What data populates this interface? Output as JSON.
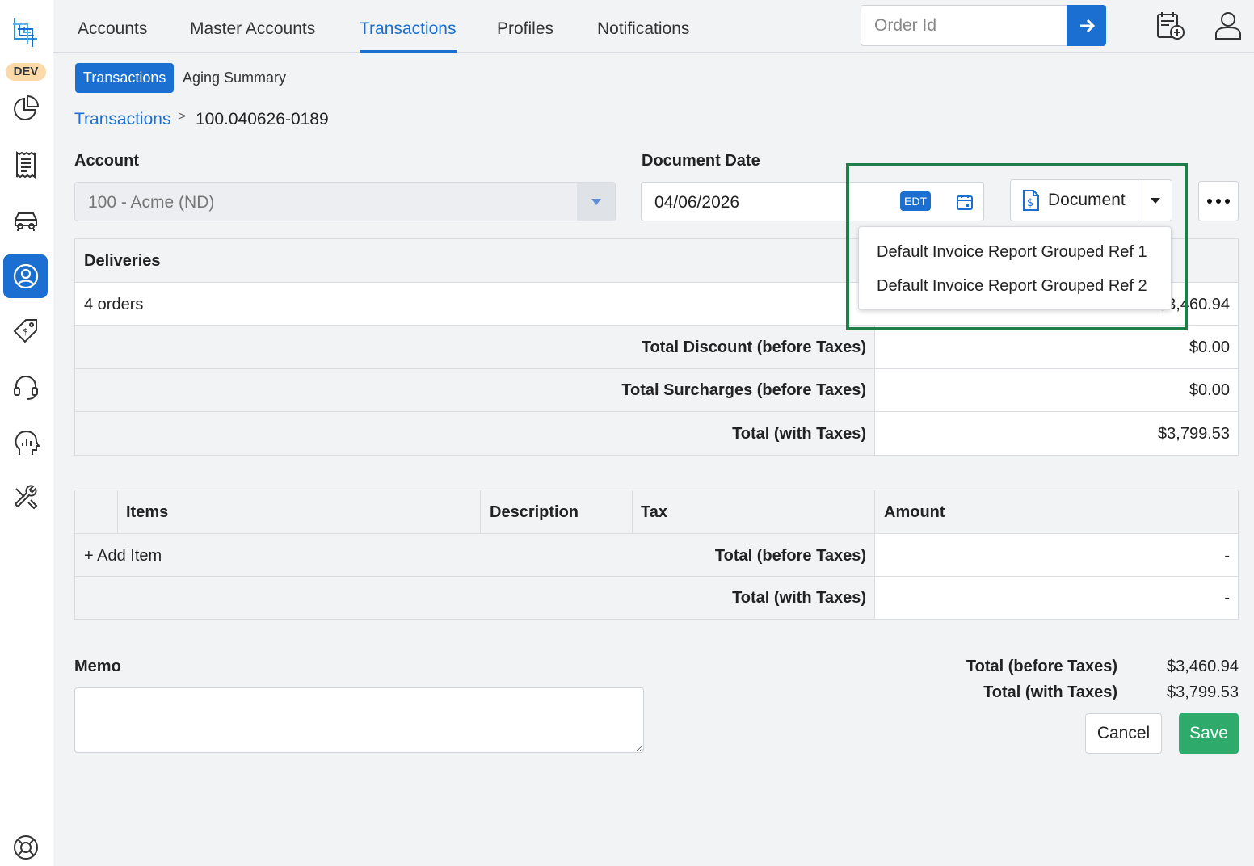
{
  "sidebar": {
    "env_badge": "DEV",
    "items": [
      {
        "icon": "pie-chart-icon"
      },
      {
        "icon": "receipt-icon"
      },
      {
        "icon": "truck-icon"
      },
      {
        "icon": "user-circle-icon",
        "active": true
      },
      {
        "icon": "price-tag-icon"
      },
      {
        "icon": "headset-icon"
      },
      {
        "icon": "analytics-head-icon"
      },
      {
        "icon": "tools-icon"
      },
      {
        "icon": "lifebuoy-icon"
      }
    ]
  },
  "topnav": {
    "tabs": [
      "Accounts",
      "Master Accounts",
      "Transactions",
      "Profiles",
      "Notifications"
    ],
    "active_tab": "Transactions",
    "order_placeholder": "Order Id"
  },
  "subtabs": [
    "Transactions",
    "Aging Summary"
  ],
  "breadcrumb": {
    "parent": "Transactions",
    "separator": ">",
    "current": "100.040626-0189"
  },
  "form": {
    "account_label": "Account",
    "account_value": "100 - Acme (ND)",
    "date_label": "Document Date",
    "date_value": "04/06/2026",
    "timezone": "EDT",
    "document_button": "Document",
    "document_menu": [
      "Default Invoice Report Grouped Ref 1",
      "Default Invoice Report Grouped Ref 2"
    ]
  },
  "deliveries": {
    "header": "Deliveries",
    "orders_label": "4 orders",
    "orders_amount": "$3,460.94",
    "total_discount_label": "Total Discount (before Taxes)",
    "total_discount_value": "$0.00",
    "total_surcharges_label": "Total Surcharges (before Taxes)",
    "total_surcharges_value": "$0.00",
    "total_with_taxes_label": "Total (with Taxes)",
    "total_with_taxes_value": "$3,799.53"
  },
  "items": {
    "columns": [
      "Items",
      "Description",
      "Tax",
      "Amount"
    ],
    "add_item": "+ Add Item",
    "total_before_label": "Total (before Taxes)",
    "total_before_value": "-",
    "total_with_label": "Total (with Taxes)",
    "total_with_value": "-"
  },
  "memo_label": "Memo",
  "summary": {
    "before_label": "Total (before Taxes)",
    "before_value": "$3,460.94",
    "with_label": "Total (with Taxes)",
    "with_value": "$3,799.53"
  },
  "actions": {
    "cancel": "Cancel",
    "save": "Save"
  },
  "colors": {
    "accent": "#1a6fd1",
    "save": "#2eaa6b",
    "highlight": "#1e7e4a"
  }
}
